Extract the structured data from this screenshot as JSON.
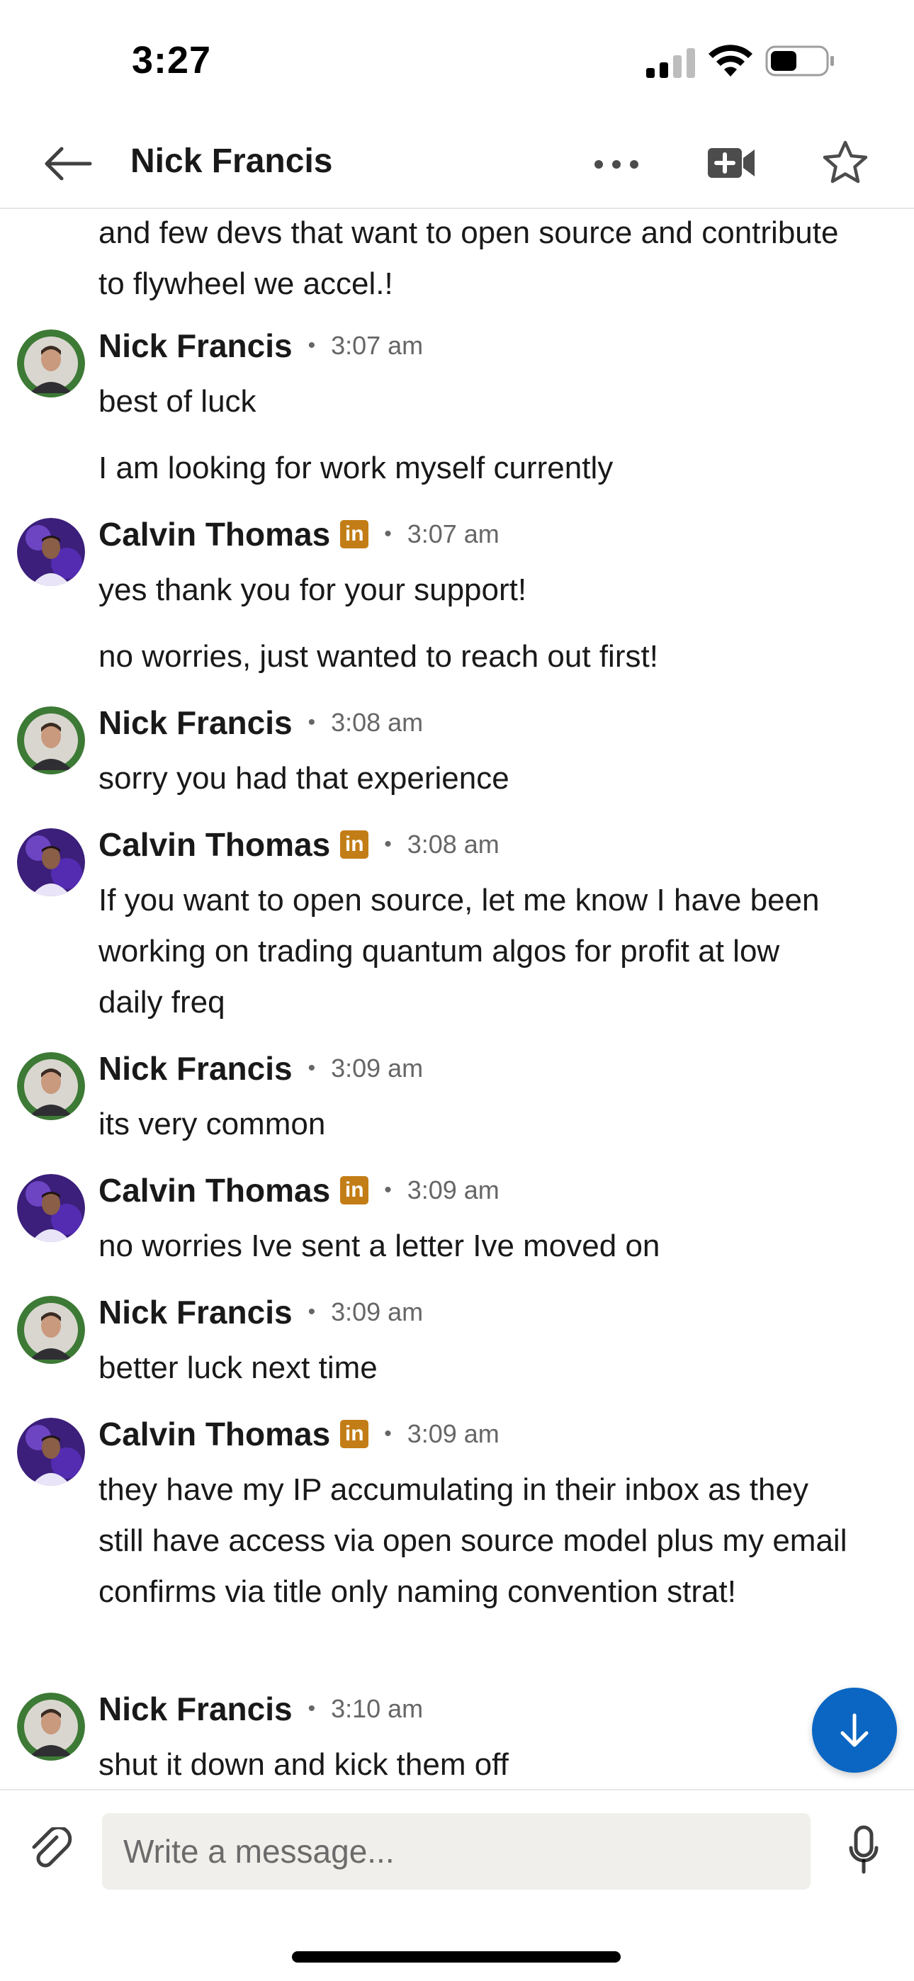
{
  "status_bar": {
    "time": "3:27"
  },
  "header": {
    "title": "Nick Francis",
    "icons": [
      "back-arrow-icon",
      "more-options-icon",
      "video-call-icon",
      "star-icon"
    ]
  },
  "messages": {
    "continued_text": "and few devs that want to open source and contribute to flywheel we accel.!",
    "groups": [
      {
        "sender": "Nick Francis",
        "time": "3:07 am",
        "linkedin_badge": false,
        "lines": [
          "best of luck",
          "I am looking for work myself currently"
        ]
      },
      {
        "sender": "Calvin Thomas",
        "time": "3:07 am",
        "linkedin_badge": true,
        "lines": [
          "yes thank you for your support!",
          "no worries, just wanted to reach out first!"
        ]
      },
      {
        "sender": "Nick Francis",
        "time": "3:08 am",
        "linkedin_badge": false,
        "lines": [
          "sorry you had that experience"
        ]
      },
      {
        "sender": "Calvin Thomas",
        "time": "3:08 am",
        "linkedin_badge": true,
        "lines": [
          "If you want to open source, let me know I have been working on trading quantum algos for profit at low daily freq"
        ]
      },
      {
        "sender": "Nick Francis",
        "time": "3:09 am",
        "linkedin_badge": false,
        "lines": [
          "its very common"
        ]
      },
      {
        "sender": "Calvin Thomas",
        "time": "3:09 am",
        "linkedin_badge": true,
        "lines": [
          "no worries Ive sent a letter Ive moved on"
        ]
      },
      {
        "sender": "Nick Francis",
        "time": "3:09 am",
        "linkedin_badge": false,
        "lines": [
          "better luck next time"
        ]
      },
      {
        "sender": "Calvin Thomas",
        "time": "3:09 am",
        "linkedin_badge": true,
        "lines": [
          "they have my IP accumulating in their inbox as they still have access via open source model plus my email confirms via title only naming convention strat!"
        ]
      },
      {
        "sender": "Nick Francis",
        "time": "3:10 am",
        "linkedin_badge": false,
        "lines": [
          "shut it down and kick them off"
        ]
      }
    ],
    "separator": "•",
    "linkedin_badge_text": "in"
  },
  "composer": {
    "placeholder": "Write a message..."
  },
  "colors": {
    "brand_blue": "#0a66c2",
    "linkedin_badge": "#c37d16",
    "input_bg": "#f1efeb"
  }
}
